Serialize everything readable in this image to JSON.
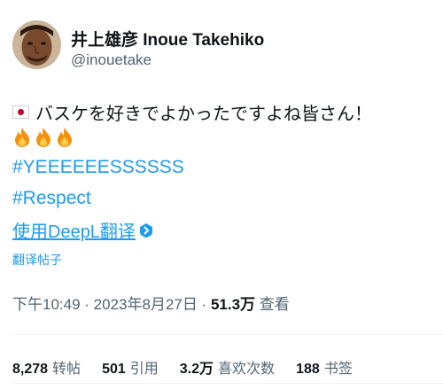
{
  "author": {
    "display_name": "井上雄彦 Inoue Takehiko",
    "handle": "@inouetake"
  },
  "tweet": {
    "flag_icon": "japan-flag-icon",
    "text_line1": "バスケを好きでよかったですよね皆さん！",
    "fire_emoji_count": 3,
    "hashtags": [
      "#YEEEEEESSSSSS",
      "#Respect"
    ],
    "translate_link": "使用DeepL翻译",
    "translate_post": "翻译帖子"
  },
  "meta": {
    "timestamp": "下午10:49 · 2023年8月27日 · ",
    "views_count": "51.3万",
    "views_label": " 查看"
  },
  "stats": {
    "reposts_count": "8,278",
    "reposts_label": "转帖",
    "quotes_count": "501",
    "quotes_label": "引用",
    "likes_count": "3.2万",
    "likes_label": "喜欢次数",
    "bookmarks_count": "188",
    "bookmarks_label": "书签"
  },
  "colors": {
    "link_blue": "#1d9bf0",
    "secondary_text": "#536471",
    "primary_text": "#0f1419"
  }
}
